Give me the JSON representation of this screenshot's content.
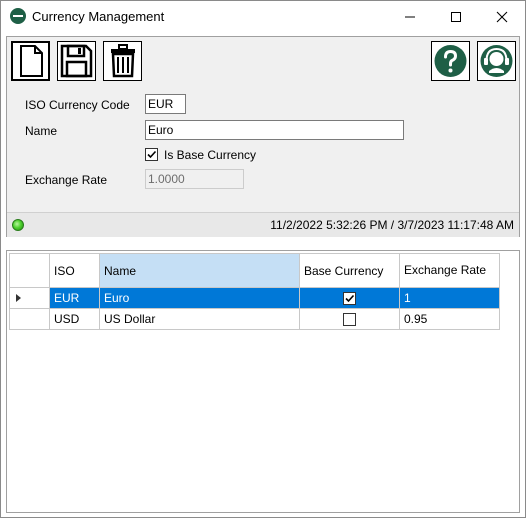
{
  "window": {
    "title": "Currency Management",
    "icons": {
      "app": "app-logo-icon",
      "minimize": "minimize-icon",
      "maximize": "maximize-icon",
      "close": "close-icon"
    }
  },
  "toolbar": {
    "icons": [
      "new-document-icon",
      "save-icon",
      "delete-trash-icon",
      "help-icon",
      "support-headset-icon"
    ]
  },
  "form": {
    "iso_label": "ISO Currency Code",
    "iso_value": "EUR",
    "name_label": "Name",
    "name_value": "Euro",
    "base_currency_label": "Is Base Currency",
    "base_currency_checked": true,
    "exchange_rate_label": "Exchange Rate",
    "exchange_rate_value": "1.0000"
  },
  "status": {
    "indicator": "green-status-led-icon",
    "timestamps": "11/2/2022 5:32:26 PM / 3/7/2023 11:17:48 AM"
  },
  "grid": {
    "headers": {
      "iso": "ISO",
      "name": "Name",
      "base": "Base Currency",
      "rate": "Exchange Rate"
    },
    "rows": [
      {
        "iso": "EUR",
        "name": "Euro",
        "base": true,
        "rate": "1",
        "selected": true
      },
      {
        "iso": "USD",
        "name": "US Dollar",
        "base": false,
        "rate": "0.95",
        "selected": false
      }
    ]
  },
  "colors": {
    "selection": "#0078d7",
    "selected_header": "#c5dff5",
    "panel": "#f0f0f0",
    "icon_green": "#1e5f46"
  }
}
